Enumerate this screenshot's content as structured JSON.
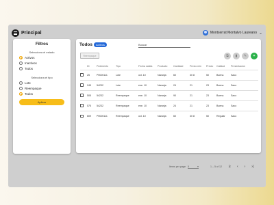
{
  "header": {
    "title": "Principal",
    "user_name": "Montserrat Montalvo Laureano"
  },
  "filters": {
    "title": "Filtros",
    "status_label": "Selecciona el estado",
    "status_options": [
      "Activos",
      "Inactivos",
      "Todos"
    ],
    "status_selected": "Activos",
    "type_label": "Selecciona el tipo",
    "type_options": [
      "Lote",
      "Reempaque",
      "Todos"
    ],
    "type_selected": "Todos",
    "apply_label": "Aplicar"
  },
  "main": {
    "title": "Todos",
    "badge": "Activos",
    "search_placeholder": "Buscar",
    "toolbar_button": "Reempaque",
    "columns": [
      "ID",
      "Pedimento",
      "Tipo",
      "Fecha salida",
      "Producto",
      "Cantidad",
      "Precio min",
      "Precio",
      "Calidad",
      "Presentacion"
    ],
    "rows": [
      [
        "25",
        "P0000111",
        "Lote",
        "oct. 10",
        "Naranja",
        "60",
        "30 8",
        "50",
        "Buena",
        "Saco"
      ],
      [
        "245",
        "54232",
        "Lote",
        "ene. 10",
        "Naranja",
        "24",
        "21",
        "23",
        "Buena",
        "Saco"
      ],
      [
        "505",
        "54232",
        "Reempaque",
        "ene. 10",
        "Naranja",
        "90",
        "21",
        "23",
        "Buena",
        "Saco"
      ],
      [
        "575",
        "54232",
        "Reempaque",
        "ene. 10",
        "Naranja",
        "24",
        "21",
        "23",
        "Buena",
        "Saco"
      ],
      [
        "609",
        "P0000111",
        "Reempaque",
        "oct. 10",
        "Naranja",
        "60",
        "30 8",
        "50",
        "Regular",
        "Saco"
      ]
    ],
    "pager": {
      "items_label": "Items per page",
      "items_value": "5",
      "range": "1 – 5 of 12"
    }
  },
  "colors": {
    "accent": "#f7bd19",
    "badge": "#2569d8",
    "add": "#2bb14a"
  },
  "icons": [
    "menu-icon",
    "avatar-icon",
    "chevron-down-icon",
    "copy-icon",
    "delete-icon",
    "edit-icon",
    "add-icon"
  ]
}
